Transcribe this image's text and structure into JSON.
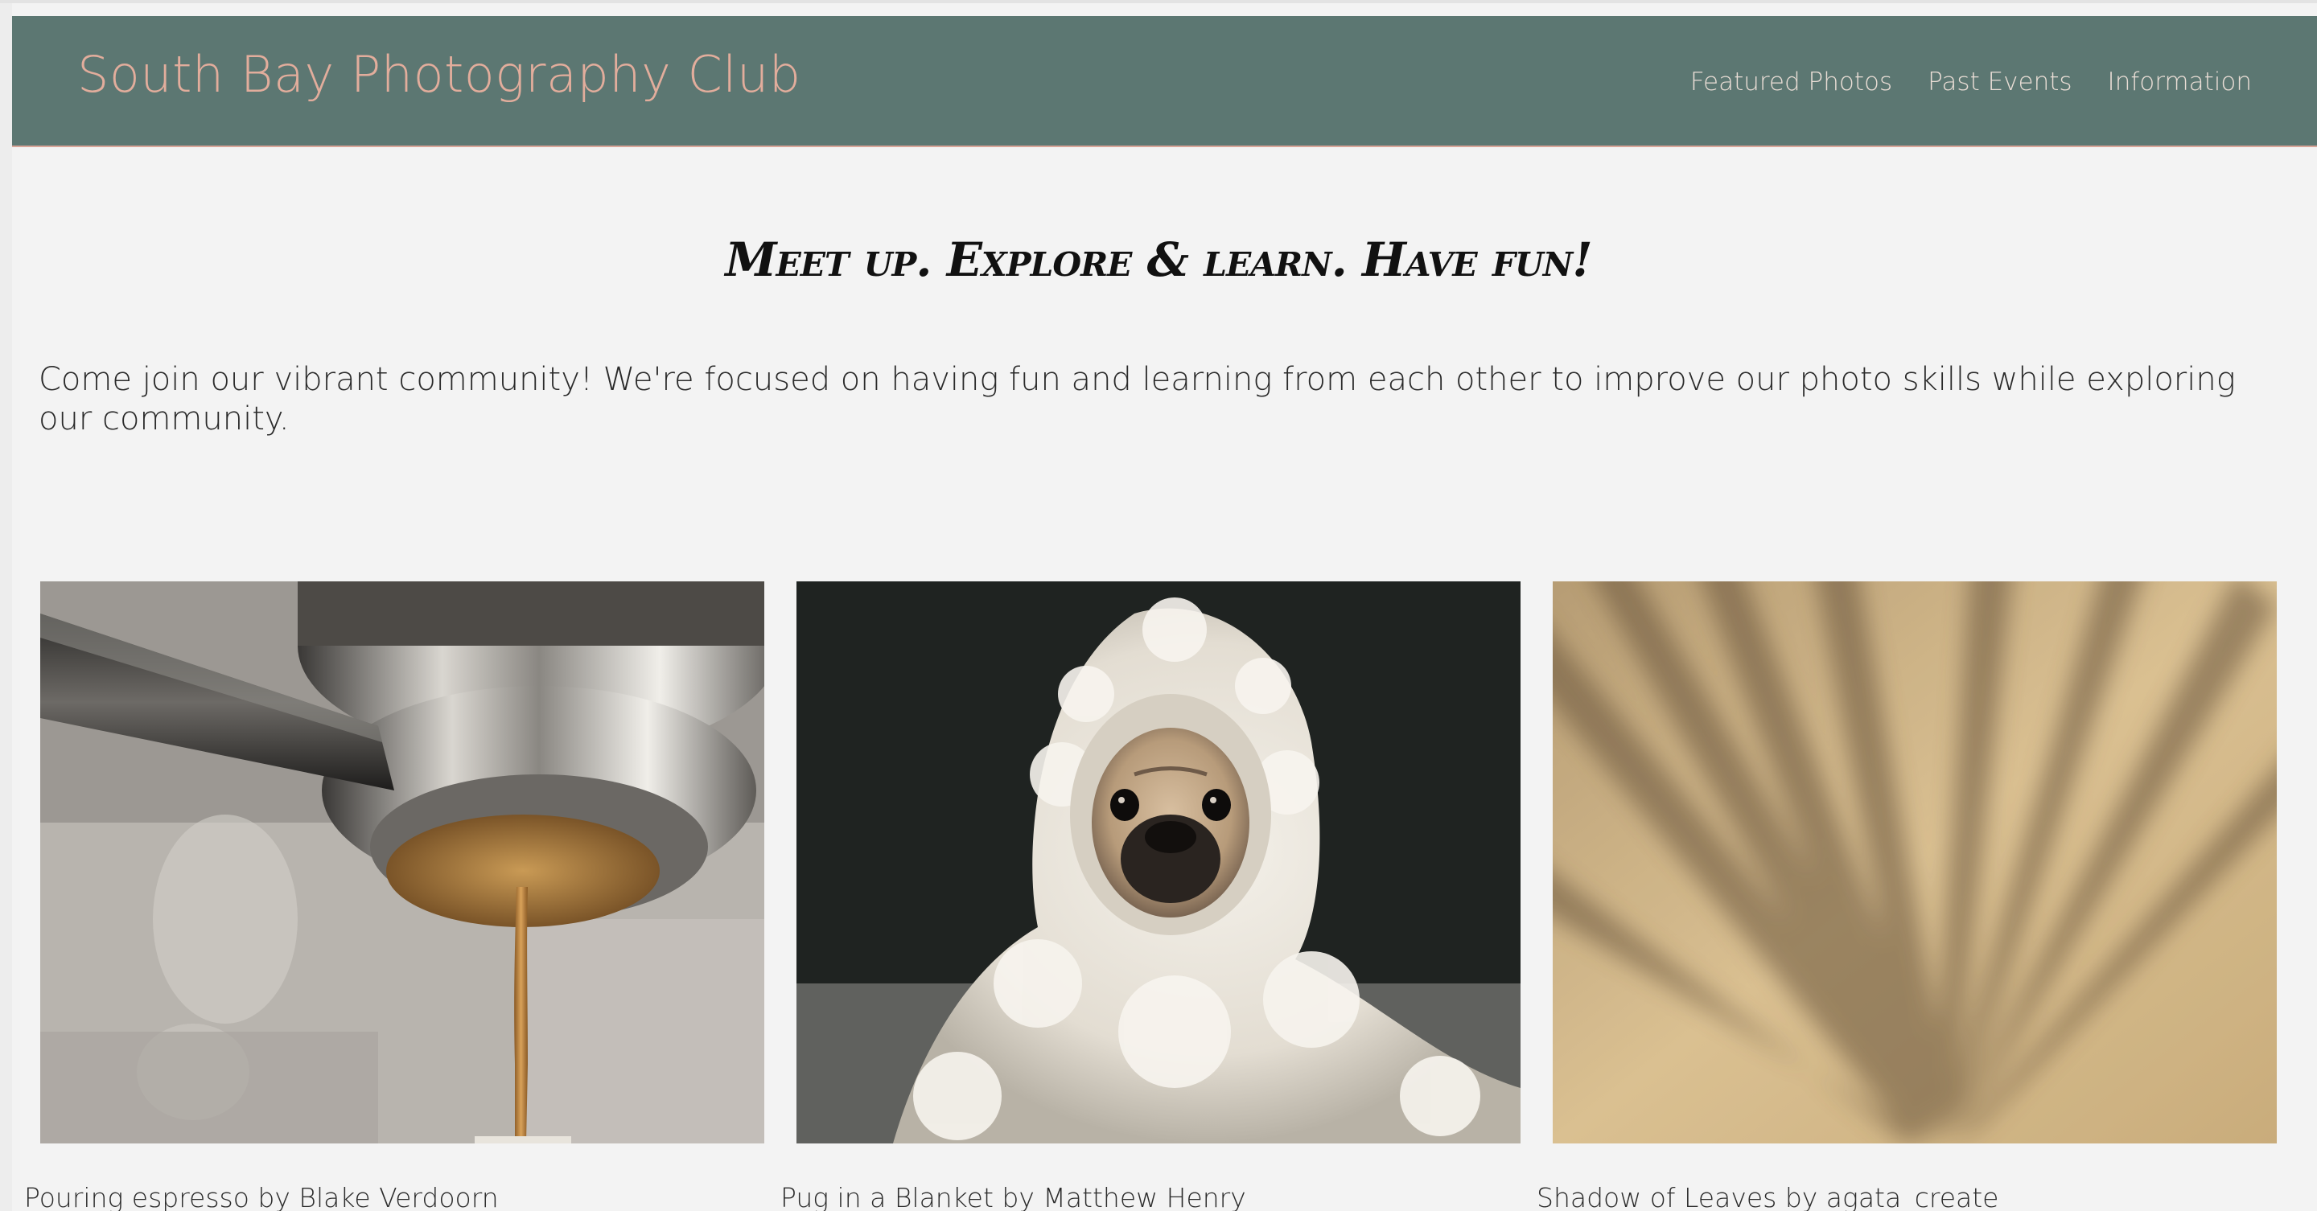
{
  "header": {
    "site_title": "South Bay Photography Club",
    "nav": [
      {
        "label": "Featured Photos"
      },
      {
        "label": "Past Events"
      },
      {
        "label": "Information"
      }
    ]
  },
  "main": {
    "tagline": "Meet up. Explore & learn. Have fun!",
    "intro": "Come join our vibrant community! We're focused on having fun and learning from each other to improve our photo skills while exploring our community.",
    "photos": [
      {
        "caption": "Pouring espresso by Blake Verdoorn",
        "subject": "espresso-machine"
      },
      {
        "caption": "Pug in a Blanket by Matthew Henry",
        "subject": "pug-in-blanket"
      },
      {
        "caption": "Shadow of Leaves by agata_create",
        "subject": "leaf-shadows"
      }
    ]
  },
  "colors": {
    "navbar_bg": "#5c7772",
    "title_accent": "#e2ad9c",
    "page_bg": "#f3f3f3"
  }
}
